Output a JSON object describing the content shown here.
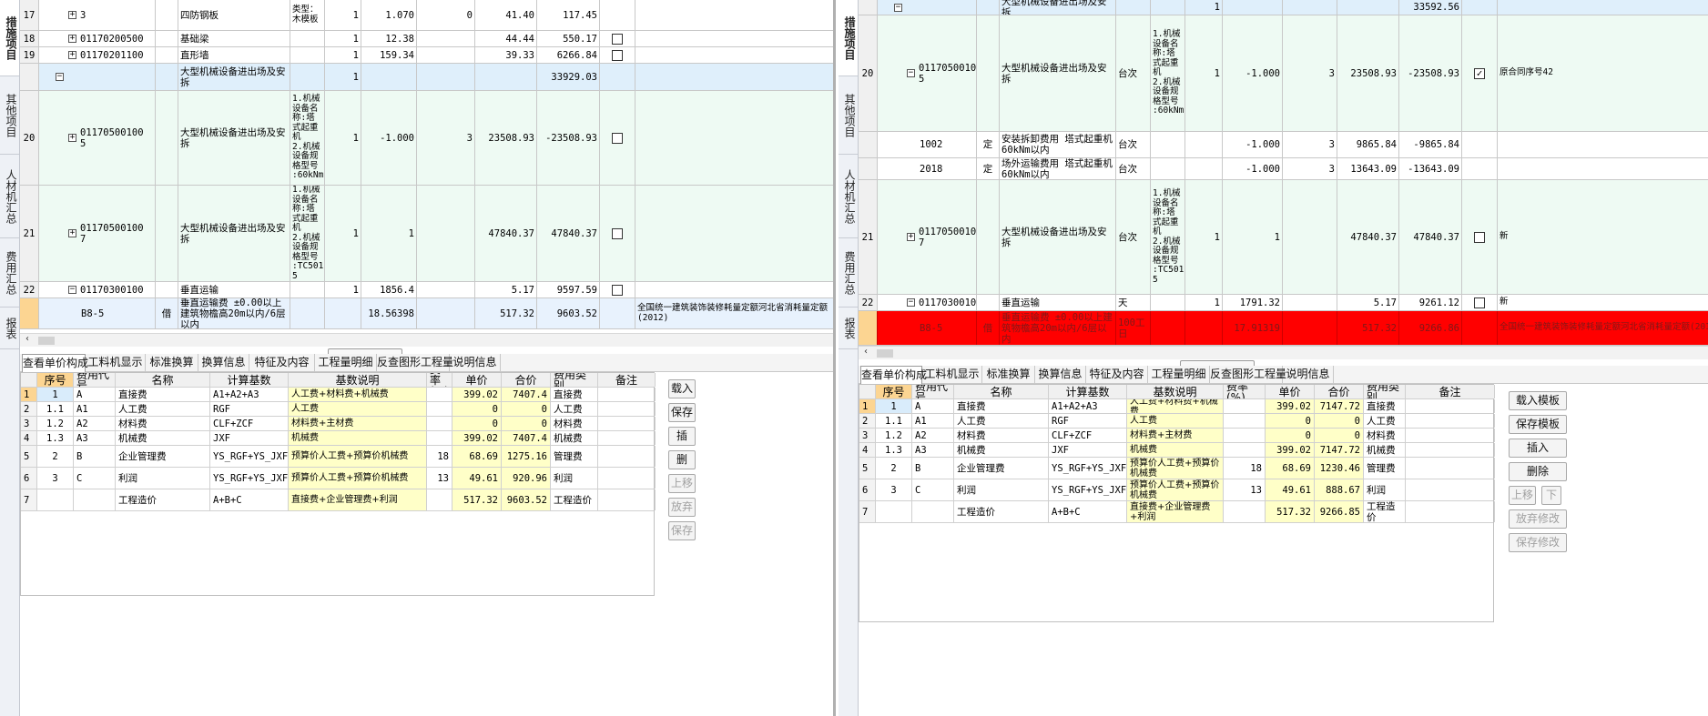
{
  "left": {
    "sidetabs": [
      {
        "label": "措施项目",
        "active": true
      },
      {
        "label": "其他项目",
        "active": false
      },
      {
        "label": "人材机汇总",
        "active": false
      },
      {
        "label": "费用汇总",
        "active": false
      },
      {
        "label": "报表",
        "active": false
      }
    ],
    "rows": [
      {
        "h": 34,
        "band": "white",
        "rn": "17",
        "code": "3",
        "name": "四防钢板",
        "spec": "类型：\n木模板",
        "qty": "1",
        "qty2": "1.070",
        "n3": "0",
        "price": "41.40",
        "total": "117.45",
        "chk": "",
        "extra": "",
        "indent": 2,
        "exp": "+"
      },
      {
        "h": 18,
        "band": "white",
        "rn": "18",
        "code": "01170200500",
        "name": "基础梁",
        "spec": "",
        "qty": "1",
        "qty2": "12.38",
        "n3": "",
        "price": "44.44",
        "total": "550.17",
        "chk": "box",
        "extra": "",
        "indent": 2,
        "exp": "+"
      },
      {
        "h": 18,
        "band": "white",
        "rn": "19",
        "code": "01170201100",
        "name": "直形墙",
        "spec": "",
        "qty": "1",
        "qty2": "159.34",
        "n3": "",
        "price": "39.33",
        "total": "6266.84",
        "chk": "box",
        "extra": "",
        "indent": 2,
        "exp": "+"
      },
      {
        "h": 30,
        "band": "blue",
        "rn": "",
        "code": "",
        "name": "大型机械设备进出场及安拆",
        "spec": "",
        "qty": "1",
        "qty2": "",
        "n3": "",
        "price": "",
        "total": "33929.03",
        "chk": "",
        "extra": "",
        "indent": 1,
        "exp": "−"
      },
      {
        "h": 104,
        "band": "green",
        "rn": "20",
        "code": "01170500100\n5",
        "name": "大型机械设备进出场及安拆",
        "spec": "1.机械\n设备名\n称:塔\n式起重\n机\n2.机械\n设备规\n格型号\n:60kNm",
        "qty": "1",
        "qty2": "-1.000",
        "n3": "3",
        "price": "23508.93",
        "total": "-23508.93",
        "chk": "box",
        "extra": "",
        "indent": 2,
        "exp": "+"
      },
      {
        "h": 106,
        "band": "green",
        "rn": "21",
        "code": "01170500100\n7",
        "name": "大型机械设备进出场及安拆",
        "spec": "1.机械\n设备名\n称:塔\n式起重\n机\n2.机械\n设备规\n格型号\n:TC501\n5",
        "qty": "1",
        "qty2": "1",
        "n3": "",
        "price": "47840.37",
        "total": "47840.37",
        "chk": "box",
        "extra": "",
        "indent": 2,
        "exp": "+"
      },
      {
        "h": 18,
        "band": "white",
        "rn": "22",
        "code": "01170300100",
        "name": "垂直运输",
        "spec": "",
        "qty": "1",
        "qty2": "1856.4",
        "n3": "",
        "price": "5.17",
        "total": "9597.59",
        "chk": "box",
        "extra": "",
        "indent": 2,
        "exp": "−"
      },
      {
        "h": 34,
        "band": "sel",
        "rn": "",
        "code": "B8-5",
        "type": "借",
        "name": "垂直运输费 ±0.00以上建筑物檐高20m以内/6层以内",
        "spec": "",
        "qty": "",
        "qty2": "18.56398",
        "n3": "",
        "price": "517.32",
        "total": "9603.52",
        "chk": "",
        "extra": "全国统一建筑装饰装修耗量定额河北省消耗量定额(2012)",
        "indent": 3,
        "exp": "",
        "cur": true
      }
    ],
    "tabs": [
      "查看单价构成",
      "工料机显示",
      "标准换算",
      "换算信息",
      "特征及内容",
      "工程量明细",
      "反查图形工程量",
      "说明信息"
    ],
    "cost_headers": [
      "序号",
      "费用代号",
      "名称",
      "计算基数",
      "基数说明",
      "费率(%)",
      "单价",
      "合价",
      "费用类别",
      "备注"
    ],
    "cost_rows": [
      {
        "rn": "1",
        "seq": "1",
        "code": "A",
        "name": "直接费",
        "base": "A1+A2+A3",
        "desc": "人工费+材料费+机械费",
        "rate": "",
        "unit": "399.02",
        "total": "7407.4",
        "cat": "直接费",
        "note": ""
      },
      {
        "rn": "2",
        "seq": "1.1",
        "code": "A1",
        "name": "人工费",
        "base": "RGF",
        "desc": "人工费",
        "rate": "",
        "unit": "0",
        "total": "0",
        "cat": "人工费",
        "note": ""
      },
      {
        "rn": "3",
        "seq": "1.2",
        "code": "A2",
        "name": "材料费",
        "base": "CLF+ZCF",
        "desc": "材料费+主材费",
        "rate": "",
        "unit": "0",
        "total": "0",
        "cat": "材料费",
        "note": ""
      },
      {
        "rn": "4",
        "seq": "1.3",
        "code": "A3",
        "name": "机械费",
        "base": "JXF",
        "desc": "机械费",
        "rate": "",
        "unit": "399.02",
        "total": "7407.4",
        "cat": "机械费",
        "note": ""
      },
      {
        "rn": "5",
        "seq": "2",
        "code": "B",
        "name": "企业管理费",
        "base": "YS_RGF+YS_JXF",
        "desc": "预算价人工费+预算价机械费",
        "rate": "18",
        "unit": "68.69",
        "total": "1275.16",
        "cat": "管理费",
        "note": ""
      },
      {
        "rn": "6",
        "seq": "3",
        "code": "C",
        "name": "利润",
        "base": "YS_RGF+YS_JXF",
        "desc": "预算价人工费+预算价机械费",
        "rate": "13",
        "unit": "49.61",
        "total": "920.96",
        "cat": "利润",
        "note": ""
      },
      {
        "rn": "7",
        "seq": "",
        "code": "",
        "name": "工程造价",
        "base": "A+B+C",
        "desc": "直接费+企业管理费+利润",
        "rate": "",
        "unit": "517.32",
        "total": "9603.52",
        "cat": "工程造价",
        "note": ""
      }
    ],
    "buttons": [
      "载入",
      "保存",
      "插",
      "删",
      "上移",
      "放弃",
      "保存"
    ]
  },
  "right": {
    "sidetabs": [
      {
        "label": "措施项目",
        "active": true
      },
      {
        "label": "其他项目",
        "active": false
      },
      {
        "label": "人材机汇总",
        "active": false
      },
      {
        "label": "费用汇总",
        "active": false
      },
      {
        "label": "报表",
        "active": false
      }
    ],
    "rows": [
      {
        "h": 17,
        "band": "blue",
        "rn": "",
        "code": "",
        "type": "",
        "name": "大型机械设备进出场及安拆",
        "unit": "",
        "spec": "",
        "qty": "1",
        "qty2": "",
        "n3": "",
        "price": "",
        "total": "33592.56",
        "chk": "",
        "extra": "",
        "indent": 1,
        "exp": "−"
      },
      {
        "h": 128,
        "band": "green",
        "rn": "20",
        "code": "01170500100\n5",
        "type": "",
        "name": "大型机械设备进出场及安拆",
        "unit": "台次",
        "spec": "1.机械\n设备名\n称:塔\n式起重\n机\n2.机械\n设备规\n格型号\n:60kNm",
        "qty": "1",
        "qty2": "-1.000",
        "n3": "3",
        "price": "23508.93",
        "total": "-23508.93",
        "chk": "checked",
        "extra": "原合同序号42",
        "indent": 2,
        "exp": "−"
      },
      {
        "h": 29,
        "band": "white",
        "rn": "",
        "code": "1002",
        "type": "定",
        "name": "安装拆卸费用 塔式起重机 60kNm以内",
        "unit": "台次",
        "spec": "",
        "qty": "",
        "qty2": "-1.000",
        "n3": "3",
        "price": "9865.84",
        "total": "-9865.84",
        "chk": "",
        "extra": "",
        "indent": 3,
        "exp": ""
      },
      {
        "h": 24,
        "band": "white",
        "rn": "",
        "code": "2018",
        "type": "定",
        "name": "场外运输费用 塔式起重机 60kNm以内",
        "unit": "台次",
        "spec": "",
        "qty": "",
        "qty2": "-1.000",
        "n3": "3",
        "price": "13643.09",
        "total": "-13643.09",
        "chk": "",
        "extra": "",
        "indent": 3,
        "exp": ""
      },
      {
        "h": 126,
        "band": "green",
        "rn": "21",
        "code": "01170500100\n7",
        "type": "",
        "name": "大型机械设备进出场及安拆",
        "unit": "台次",
        "spec": "1.机械\n设备名\n称:塔\n式起重\n机\n2.机械\n设备规\n格型号\n:TC501\n5",
        "qty": "1",
        "qty2": "1",
        "n3": "",
        "price": "47840.37",
        "total": "47840.37",
        "chk": "box",
        "extra": "新",
        "indent": 2,
        "exp": "+"
      },
      {
        "h": 18,
        "band": "white",
        "rn": "22",
        "code": "01170300100",
        "type": "",
        "name": "垂直运输",
        "unit": "天",
        "spec": "",
        "qty": "1",
        "qty2": "1791.32",
        "n3": "",
        "price": "5.17",
        "total": "9261.12",
        "chk": "box",
        "extra": "新",
        "indent": 2,
        "exp": "−"
      },
      {
        "h": 38,
        "band": "red",
        "rn": "",
        "code": "B8-5",
        "type": "借",
        "name": "垂直运输费 ±0.00以上建筑物檐高20m以内/6层以内",
        "unit": "100工日",
        "spec": "",
        "qty": "",
        "qty2": "17.91319",
        "n3": "",
        "price": "517.32",
        "total": "9266.86",
        "chk": "",
        "extra": "全国统一建筑装饰装修耗量定额河北省消耗量定额(2012)",
        "indent": 3,
        "exp": "",
        "cur": true
      }
    ],
    "tabs": [
      "查看单价构成",
      "工料机显示",
      "标准换算",
      "换算信息",
      "特征及内容",
      "工程量明细",
      "反查图形工程量",
      "说明信息"
    ],
    "cost_headers": [
      "序号",
      "费用代号",
      "名称",
      "计算基数",
      "基数说明",
      "费率(%)",
      "单价",
      "合价",
      "费用类别",
      "备注"
    ],
    "cost_rows": [
      {
        "rn": "1",
        "seq": "1",
        "code": "A",
        "name": "直接费",
        "base": "A1+A2+A3",
        "desc": "人工费+材料费+机械费",
        "rate": "",
        "unit": "399.02",
        "total": "7147.72",
        "cat": "直接费",
        "note": ""
      },
      {
        "rn": "2",
        "seq": "1.1",
        "code": "A1",
        "name": "人工费",
        "base": "RGF",
        "desc": "人工费",
        "rate": "",
        "unit": "0",
        "total": "0",
        "cat": "人工费",
        "note": ""
      },
      {
        "rn": "3",
        "seq": "1.2",
        "code": "A2",
        "name": "材料费",
        "base": "CLF+ZCF",
        "desc": "材料费+主材费",
        "rate": "",
        "unit": "0",
        "total": "0",
        "cat": "材料费",
        "note": ""
      },
      {
        "rn": "4",
        "seq": "1.3",
        "code": "A3",
        "name": "机械费",
        "base": "JXF",
        "desc": "机械费",
        "rate": "",
        "unit": "399.02",
        "total": "7147.72",
        "cat": "机械费",
        "note": ""
      },
      {
        "rn": "5",
        "seq": "2",
        "code": "B",
        "name": "企业管理费",
        "base": "YS_RGF+YS_JXF",
        "desc": "预算价人工费+预算价机械费",
        "rate": "18",
        "unit": "68.69",
        "total": "1230.46",
        "cat": "管理费",
        "note": ""
      },
      {
        "rn": "6",
        "seq": "3",
        "code": "C",
        "name": "利润",
        "base": "YS_RGF+YS_JXF",
        "desc": "预算价人工费+预算价机械费",
        "rate": "13",
        "unit": "49.61",
        "total": "888.67",
        "cat": "利润",
        "note": ""
      },
      {
        "rn": "7",
        "seq": "",
        "code": "",
        "name": "工程造价",
        "base": "A+B+C",
        "desc": "直接费+企业管理费+利润",
        "rate": "",
        "unit": "517.32",
        "total": "9266.85",
        "cat": "工程造价",
        "note": ""
      }
    ],
    "buttons": [
      "载入模板",
      "保存模板",
      "插入",
      "删除",
      "上移",
      "下",
      "放弃修改",
      "保存修改"
    ]
  }
}
